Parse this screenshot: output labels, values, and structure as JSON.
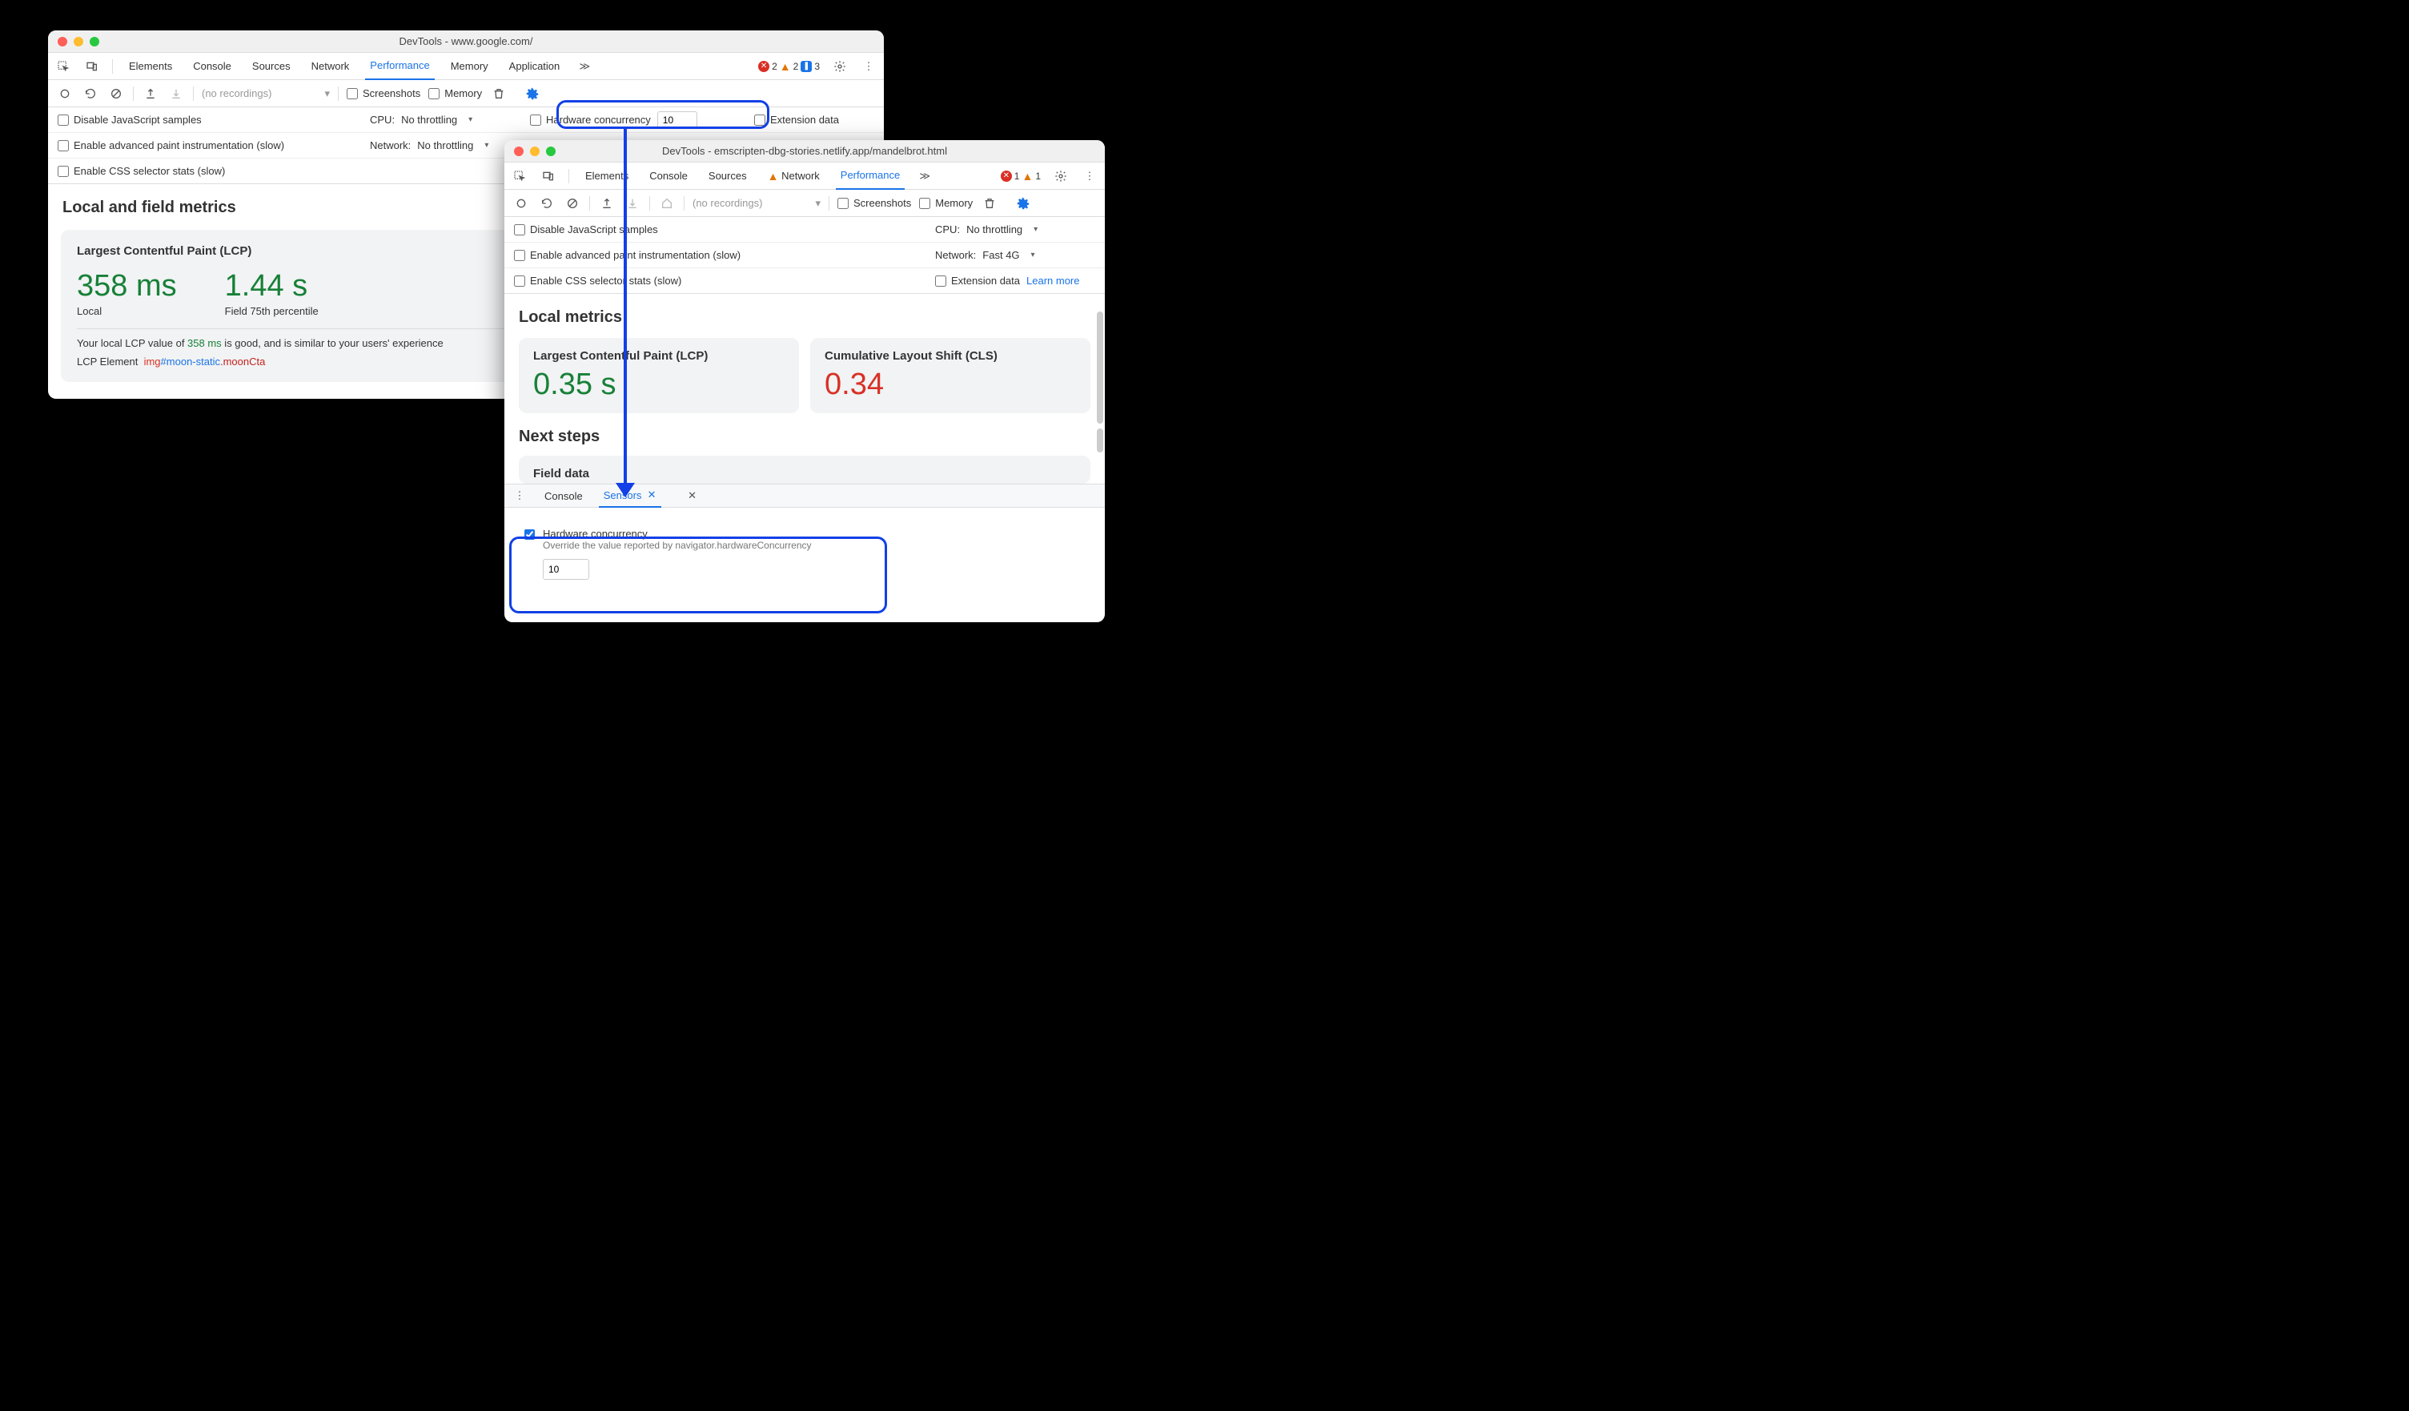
{
  "colors": {
    "accent": "#1a73e8",
    "good": "#188038",
    "bad": "#d93025",
    "highlight": "#1240e6"
  },
  "win1": {
    "title": "DevTools - www.google.com/",
    "tabs": [
      "Elements",
      "Console",
      "Sources",
      "Network",
      "Performance",
      "Memory",
      "Application"
    ],
    "active_tab": "Performance",
    "issues": {
      "errors": 2,
      "warnings": 2,
      "info": 3
    },
    "toolbar": {
      "recordings": "(no recordings)",
      "screenshots_label": "Screenshots",
      "memory_label": "Memory"
    },
    "settings": {
      "opt1": "Disable JavaScript samples",
      "opt2": "Enable advanced paint instrumentation (slow)",
      "opt3": "Enable CSS selector stats (slow)",
      "cpu_label": "CPU:",
      "cpu_value": "No throttling",
      "net_label": "Network:",
      "net_value": "No throttling",
      "hw_label": "Hardware concurrency",
      "hw_value": "10",
      "ext_label": "Extension data"
    },
    "content": {
      "heading": "Local and field metrics",
      "lcp_title": "Largest Contentful Paint (LCP)",
      "lcp_local": "358 ms",
      "lcp_local_label": "Local",
      "lcp_field": "1.44 s",
      "lcp_field_label": "Field 75th percentile",
      "desc_pre": "Your local LCP value of ",
      "desc_val": "358 ms",
      "desc_post": " is good, and is similar to your users' experience",
      "elem_label": "LCP Element",
      "elem_tag": "img",
      "elem_id": "#moon-static",
      "elem_class": ".moonCta"
    }
  },
  "win2": {
    "title": "DevTools - emscripten-dbg-stories.netlify.app/mandelbrot.html",
    "tabs": [
      "Elements",
      "Console",
      "Sources",
      "Network",
      "Performance"
    ],
    "active_tab": "Performance",
    "network_has_warn": true,
    "issues": {
      "errors": 1,
      "warnings": 1
    },
    "toolbar": {
      "recordings": "(no recordings)",
      "screenshots_label": "Screenshots",
      "memory_label": "Memory"
    },
    "settings": {
      "opt1": "Disable JavaScript samples",
      "opt2": "Enable advanced paint instrumentation (slow)",
      "opt3": "Enable CSS selector stats (slow)",
      "cpu_label": "CPU:",
      "cpu_value": "No throttling",
      "net_label": "Network:",
      "net_value": "Fast 4G",
      "ext_label": "Extension data",
      "learn_more": "Learn more"
    },
    "content": {
      "heading": "Local metrics",
      "lcp_title": "Largest Contentful Paint (LCP)",
      "lcp_val": "0.35 s",
      "cls_title": "Cumulative Layout Shift (CLS)",
      "cls_val": "0.34",
      "next_heading": "Next steps",
      "field_heading": "Field data"
    },
    "drawer": {
      "tabs": [
        "Console",
        "Sensors"
      ],
      "active": "Sensors",
      "hw_label": "Hardware concurrency",
      "hw_desc": "Override the value reported by navigator.hardwareConcurrency",
      "hw_value": "10",
      "hw_checked": true
    }
  }
}
